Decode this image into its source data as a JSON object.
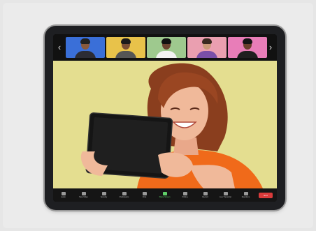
{
  "thumbnails": [
    {
      "name": "participant-1",
      "bg": "#3a6fd8",
      "skin": "#8a5a3c",
      "hair": "#222222",
      "shirt": "#2c2c34"
    },
    {
      "name": "participant-2",
      "bg": "#e8c24a",
      "skin": "#7b4f34",
      "hair": "#1b1b1b",
      "shirt": "#555555"
    },
    {
      "name": "participant-3",
      "bg": "#9ec98e",
      "skin": "#6b4330",
      "hair": "#111111",
      "shirt": "#f2f2f2"
    },
    {
      "name": "participant-4",
      "bg": "#ea9fb0",
      "skin": "#c99a78",
      "hair": "#3a2a20",
      "shirt": "#7a4fa8"
    },
    {
      "name": "participant-5",
      "bg": "#e87db8",
      "skin": "#6a3f2c",
      "hair": "#141414",
      "shirt": "#1f1f1f"
    }
  ],
  "colors": {
    "main_bg": "#e4de90",
    "end_button": "#d93b3b",
    "share_green": "#5fd068"
  },
  "controls": [
    {
      "label": "Audio",
      "icon": "microphone-icon"
    },
    {
      "label": "Stop Video",
      "icon": "video-camera-icon"
    },
    {
      "label": "Security",
      "icon": "shield-icon"
    },
    {
      "label": "Participants",
      "icon": "participants-icon"
    },
    {
      "label": "Chat",
      "icon": "chat-icon"
    },
    {
      "label": "Share Screen",
      "icon": "share-screen-icon",
      "active": true
    },
    {
      "label": "Polling",
      "icon": "polling-icon"
    },
    {
      "label": "Record",
      "icon": "record-icon"
    },
    {
      "label": "Live Transcript",
      "icon": "captions-icon"
    },
    {
      "label": "Reactions",
      "icon": "smile-icon"
    }
  ],
  "end_button_label": "End"
}
